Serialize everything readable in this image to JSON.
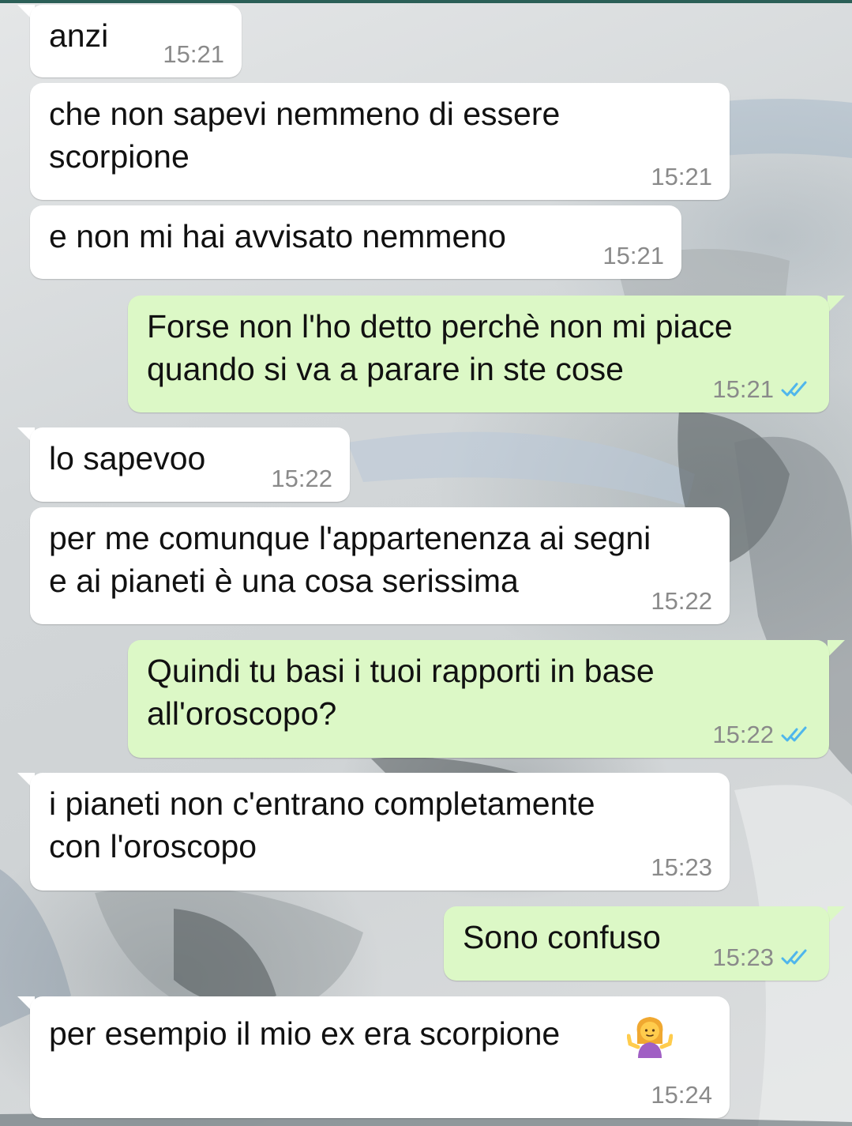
{
  "chat": {
    "messages": [
      {
        "text": "anzi",
        "time": "15:21",
        "direction": "incoming"
      },
      {
        "text": "che non sapevi nemmeno di essere\nscorpione",
        "time": "15:21",
        "direction": "incoming"
      },
      {
        "text": "e non mi hai avvisato nemmeno",
        "time": "15:21",
        "direction": "incoming"
      },
      {
        "text": "Forse non l'ho detto perchè non mi piace\nquando si va a parare in ste cose",
        "time": "15:21",
        "direction": "outgoing",
        "status": "read"
      },
      {
        "text": "lo sapevoo",
        "time": "15:22",
        "direction": "incoming"
      },
      {
        "text": "per me comunque l'appartenenza ai segni\ne ai pianeti è una cosa serissima",
        "time": "15:22",
        "direction": "incoming"
      },
      {
        "text": "Quindi tu basi i tuoi rapporti in base\nall'oroscopo?",
        "time": "15:22",
        "direction": "outgoing",
        "status": "read"
      },
      {
        "text": "i pianeti non c'entrano completamente\ncon l'oroscopo",
        "time": "15:23",
        "direction": "incoming"
      },
      {
        "text": "Sono confuso",
        "time": "15:23",
        "direction": "outgoing",
        "status": "read"
      },
      {
        "text": "per esempio il mio ex era scorpione",
        "time": "15:24",
        "direction": "incoming",
        "emoji": "person-shrugging-emoji"
      }
    ]
  },
  "colors": {
    "incoming_bubble": "#ffffff",
    "outgoing_bubble": "#dcf8c6",
    "read_ticks": "#4fb6ec",
    "timestamp": "#8a8a8a",
    "header_strip": "#2b5f57"
  },
  "icons": {
    "read_receipt": "double-check-icon"
  }
}
